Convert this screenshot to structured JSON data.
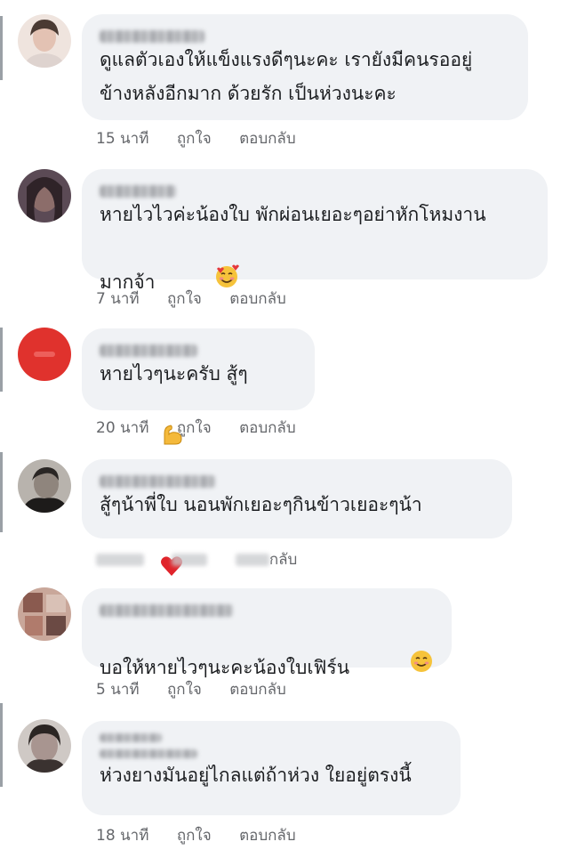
{
  "comments": [
    {
      "author": "",
      "text": "ดูแลตัวเองให้แข็งแรงดีๆนะคะ เรายังมีคนรออยู่\nข้างหลังอีกมาก ด้วยรัก เป็นห่วงนะคะ",
      "time": "15 นาที",
      "like": "ถูกใจ",
      "reply": "ตอบกลับ",
      "avatar_color": "#d9b8a8"
    },
    {
      "author": "",
      "text": "หายไวไวค่ะน้องใบ พักผ่อนเยอะๆอย่าหักโหมงาน\nมากจ้า",
      "emoji": "smiling-face-with-hearts",
      "time": "7 นาที",
      "like": "ถูกใจ",
      "reply": "ตอบกลับ",
      "avatar_color": "#5b4a55"
    },
    {
      "author": "",
      "text": "หายไวๆนะครับ สู้ๆ ",
      "emoji": "flexed-biceps",
      "time": "20 นาที",
      "like": "ถูกใจ",
      "reply": "ตอบกลับ",
      "avatar_color": "#e0322d"
    },
    {
      "author": "",
      "text": "สู้ๆน้าพี่ใบ นอนพักเยอะๆกินข้าวเยอะๆน้า ",
      "emoji": "red-heart",
      "time": "",
      "like": "",
      "reply": "กลับ",
      "avatar_color": "#3b3735"
    },
    {
      "author": "",
      "text": "บอให้หายไวๆนะคะน้องใบเฟิร์น",
      "emoji": "smiling-face",
      "time": "5 นาที",
      "like": "ถูกใจ",
      "reply": "ตอบกลับ",
      "avatar_color": "#8a5a4f"
    },
    {
      "author": "",
      "text": "ห่วงยางมันอยู่ไกลแต่ถ้าห่วง ใยอยู่ตรงนี้",
      "time": "18 นาที",
      "like": "ถูกใจ",
      "reply": "ตอบกลับ",
      "avatar_color": "#5e5450"
    }
  ]
}
